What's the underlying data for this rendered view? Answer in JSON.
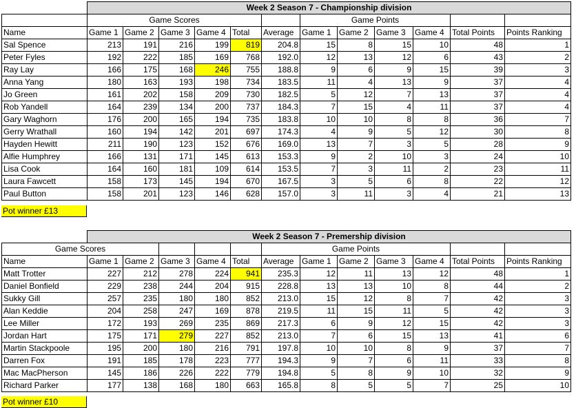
{
  "colors": {
    "highlight": "#ffff00",
    "title_bg": "#d9d9d9"
  },
  "columns": [
    "Name",
    "Game 1",
    "Game 2",
    "Game 3",
    "Game 4",
    "Total",
    "Average",
    "Game 1",
    "Game 2",
    "Game 3",
    "Game 4",
    "Total Points",
    "Points Ranking"
  ],
  "championship": {
    "title": "Week 2 Season 7 - Championship division",
    "group_scores": "Game Scores",
    "group_points": "Game Points",
    "pot": "Pot winner £13",
    "rows": [
      {
        "name": "Sal Spence",
        "g1": "213",
        "g2": "191",
        "g3": "216",
        "g4": "199",
        "total": "819",
        "avg": "204.8",
        "p1": "15",
        "p2": "8",
        "p3": "15",
        "p4": "10",
        "tp": "48",
        "rank": "1",
        "hl": "total"
      },
      {
        "name": "Peter Fyles",
        "g1": "192",
        "g2": "222",
        "g3": "185",
        "g4": "169",
        "total": "768",
        "avg": "192.0",
        "p1": "12",
        "p2": "13",
        "p3": "12",
        "p4": "6",
        "tp": "43",
        "rank": "2"
      },
      {
        "name": "Ray Lay",
        "g1": "166",
        "g2": "175",
        "g3": "168",
        "g4": "246",
        "total": "755",
        "avg": "188.8",
        "p1": "9",
        "p2": "6",
        "p3": "9",
        "p4": "15",
        "tp": "39",
        "rank": "3",
        "hl": "g4"
      },
      {
        "name": "Anna Yang",
        "g1": "180",
        "g2": "163",
        "g3": "193",
        "g4": "198",
        "total": "734",
        "avg": "183.5",
        "p1": "11",
        "p2": "4",
        "p3": "13",
        "p4": "9",
        "tp": "37",
        "rank": "4"
      },
      {
        "name": "Jo Green",
        "g1": "161",
        "g2": "202",
        "g3": "158",
        "g4": "209",
        "total": "730",
        "avg": "182.5",
        "p1": "5",
        "p2": "12",
        "p3": "7",
        "p4": "13",
        "tp": "37",
        "rank": "4"
      },
      {
        "name": "Rob Yandell",
        "g1": "164",
        "g2": "239",
        "g3": "134",
        "g4": "200",
        "total": "737",
        "avg": "184.3",
        "p1": "7",
        "p2": "15",
        "p3": "4",
        "p4": "11",
        "tp": "37",
        "rank": "4"
      },
      {
        "name": "Gary Waghorn",
        "g1": "176",
        "g2": "200",
        "g3": "165",
        "g4": "194",
        "total": "735",
        "avg": "183.8",
        "p1": "10",
        "p2": "10",
        "p3": "8",
        "p4": "8",
        "tp": "36",
        "rank": "7"
      },
      {
        "name": "Gerry Wrathall",
        "g1": "160",
        "g2": "194",
        "g3": "142",
        "g4": "201",
        "total": "697",
        "avg": "174.3",
        "p1": "4",
        "p2": "9",
        "p3": "5",
        "p4": "12",
        "tp": "30",
        "rank": "8"
      },
      {
        "name": "Hayden Hewitt",
        "g1": "211",
        "g2": "190",
        "g3": "123",
        "g4": "152",
        "total": "676",
        "avg": "169.0",
        "p1": "13",
        "p2": "7",
        "p3": "3",
        "p4": "5",
        "tp": "28",
        "rank": "9"
      },
      {
        "name": "Alfie Humphrey",
        "g1": "166",
        "g2": "131",
        "g3": "171",
        "g4": "145",
        "total": "613",
        "avg": "153.3",
        "p1": "9",
        "p2": "2",
        "p3": "10",
        "p4": "3",
        "tp": "24",
        "rank": "10"
      },
      {
        "name": "Lisa Cook",
        "g1": "164",
        "g2": "160",
        "g3": "181",
        "g4": "109",
        "total": "614",
        "avg": "153.5",
        "p1": "7",
        "p2": "3",
        "p3": "11",
        "p4": "2",
        "tp": "23",
        "rank": "11"
      },
      {
        "name": "Laura Fawcett",
        "g1": "158",
        "g2": "173",
        "g3": "145",
        "g4": "194",
        "total": "670",
        "avg": "167.5",
        "p1": "3",
        "p2": "5",
        "p3": "6",
        "p4": "8",
        "tp": "22",
        "rank": "12"
      },
      {
        "name": "Paul Button",
        "g1": "158",
        "g2": "201",
        "g3": "123",
        "g4": "146",
        "total": "628",
        "avg": "157.0",
        "p1": "3",
        "p2": "11",
        "p3": "3",
        "p4": "4",
        "tp": "21",
        "rank": "13"
      }
    ]
  },
  "premiership": {
    "title": "Week 2 Season 7 - Premership division",
    "group_scores": "Game Scores",
    "group_points": "Game Points",
    "pot": "Pot winner £10",
    "rows": [
      {
        "name": "Matt Trotter",
        "g1": "227",
        "g2": "212",
        "g3": "278",
        "g4": "224",
        "total": "941",
        "avg": "235.3",
        "p1": "12",
        "p2": "11",
        "p3": "13",
        "p4": "12",
        "tp": "48",
        "rank": "1",
        "hl": "total"
      },
      {
        "name": "Daniel Bonfield",
        "g1": "229",
        "g2": "238",
        "g3": "244",
        "g4": "204",
        "total": "915",
        "avg": "228.8",
        "p1": "13",
        "p2": "13",
        "p3": "10",
        "p4": "8",
        "tp": "44",
        "rank": "2"
      },
      {
        "name": "Sukky Gill",
        "g1": "257",
        "g2": "235",
        "g3": "180",
        "g4": "180",
        "total": "852",
        "avg": "213.0",
        "p1": "15",
        "p2": "12",
        "p3": "8",
        "p4": "7",
        "tp": "42",
        "rank": "3"
      },
      {
        "name": "Alan Keddie",
        "g1": "204",
        "g2": "258",
        "g3": "247",
        "g4": "169",
        "total": "878",
        "avg": "219.5",
        "p1": "11",
        "p2": "15",
        "p3": "11",
        "p4": "5",
        "tp": "42",
        "rank": "3"
      },
      {
        "name": "Lee Miller",
        "g1": "172",
        "g2": "193",
        "g3": "269",
        "g4": "235",
        "total": "869",
        "avg": "217.3",
        "p1": "6",
        "p2": "9",
        "p3": "12",
        "p4": "15",
        "tp": "42",
        "rank": "3"
      },
      {
        "name": "Jordan Hart",
        "g1": "175",
        "g2": "171",
        "g3": "279",
        "g4": "227",
        "total": "852",
        "avg": "213.0",
        "p1": "7",
        "p2": "6",
        "p3": "15",
        "p4": "13",
        "tp": "41",
        "rank": "6",
        "hl": "g3"
      },
      {
        "name": "Martin Stackpoole",
        "g1": "195",
        "g2": "200",
        "g3": "180",
        "g4": "216",
        "total": "791",
        "avg": "197.8",
        "p1": "10",
        "p2": "10",
        "p3": "8",
        "p4": "9",
        "tp": "37",
        "rank": "7"
      },
      {
        "name": "Darren Fox",
        "g1": "191",
        "g2": "185",
        "g3": "178",
        "g4": "223",
        "total": "777",
        "avg": "194.3",
        "p1": "9",
        "p2": "7",
        "p3": "6",
        "p4": "11",
        "tp": "33",
        "rank": "8"
      },
      {
        "name": "Mac MacPherson",
        "g1": "145",
        "g2": "186",
        "g3": "226",
        "g4": "222",
        "total": "779",
        "avg": "194.8",
        "p1": "5",
        "p2": "8",
        "p3": "9",
        "p4": "10",
        "tp": "32",
        "rank": "9"
      },
      {
        "name": "Richard Parker",
        "g1": "177",
        "g2": "138",
        "g3": "168",
        "g4": "180",
        "total": "663",
        "avg": "165.8",
        "p1": "8",
        "p2": "5",
        "p3": "5",
        "p4": "7",
        "tp": "25",
        "rank": "10"
      }
    ]
  }
}
